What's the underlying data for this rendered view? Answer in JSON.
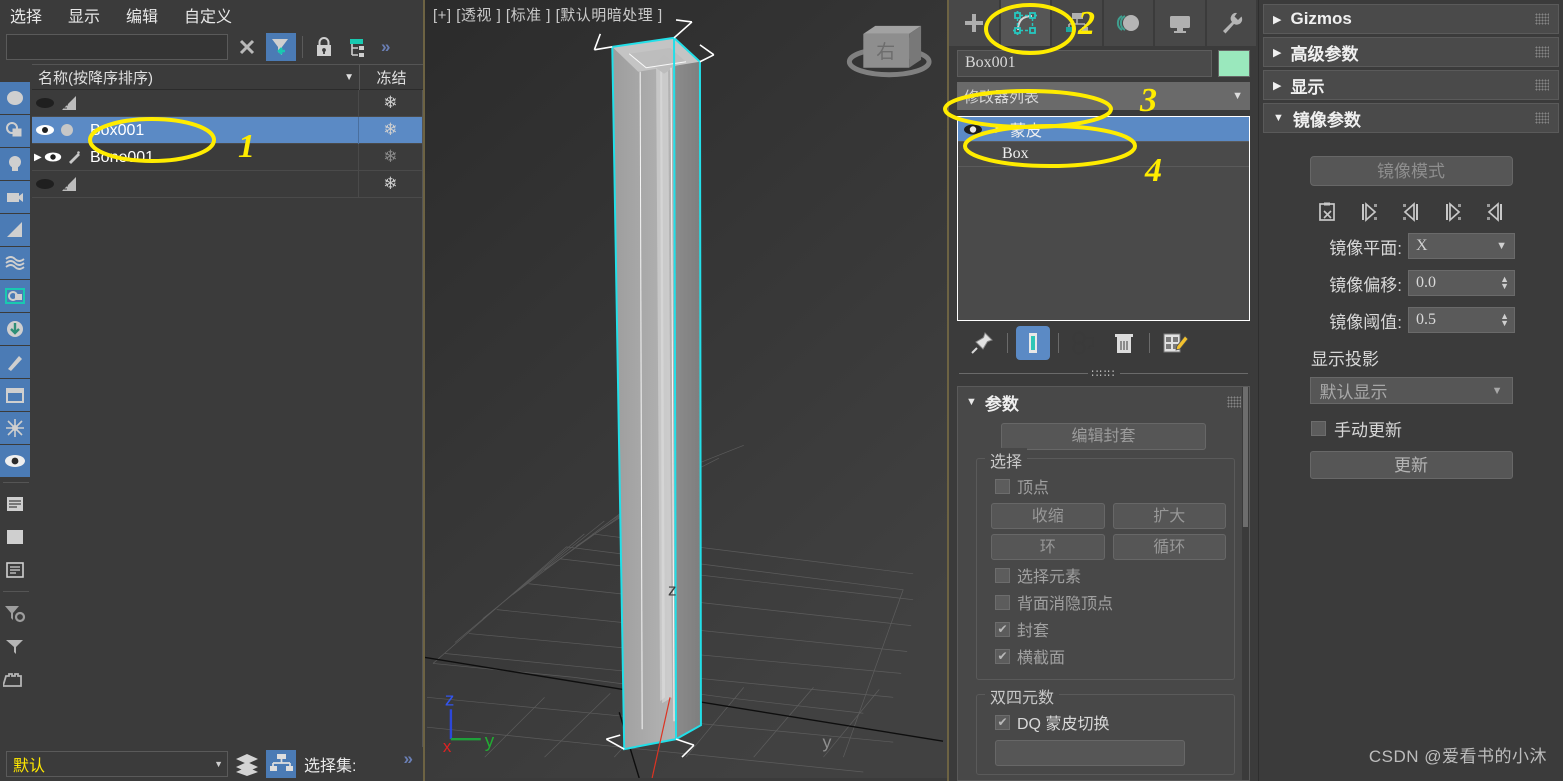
{
  "scene_explorer": {
    "menu": [
      "选择",
      "显示",
      "编辑",
      "自定义"
    ],
    "search_value": "",
    "search_placeholder": "",
    "toolbar_icons": [
      "clear-x-icon",
      "filter-icon",
      "lock-icon",
      "hierarchy-icon",
      "chevron-double-right-icon"
    ],
    "columns": {
      "name": "名称(按降序排序)",
      "frozen": "冻结"
    },
    "rows": [
      {
        "name": "",
        "selected": false,
        "visible": false,
        "type_icon": "helper-icon",
        "frozen_icon": "snowflake-icon"
      },
      {
        "name": "Box001",
        "selected": true,
        "visible": true,
        "type_icon": "geometry-icon",
        "frozen_icon": "snowflake-icon"
      },
      {
        "name": "Bone001",
        "selected": false,
        "visible": true,
        "type_icon": "bone-icon",
        "frozen_icon": "snowflake-icon"
      },
      {
        "name": "",
        "selected": false,
        "visible": false,
        "type_icon": "helper-icon",
        "frozen_icon": "snowflake-icon"
      }
    ],
    "rail_icons": [
      "geometry-sphere-icon",
      "shapes-icon",
      "lights-icon",
      "cameras-icon",
      "helpers-icon",
      "space-warps-icon",
      "groups-icon",
      "xrefs-icon",
      "bones-icon",
      "containers-icon",
      "particles-icon",
      "visibility-eye-icon",
      "layers-list-icon",
      "blank-square-icon",
      "properties-icon",
      "filter-gear-icon",
      "filter-funnel-icon",
      "container-icon"
    ],
    "bottom": {
      "layer_value": "默认",
      "layers_icon": "layers-stack-icon",
      "select_set_icon": "named-selection-sets-icon",
      "select_set_label": "选择集:",
      "overflow": "»"
    }
  },
  "viewport": {
    "label": "[+] [透视 ] [标准 ] [默认明暗处理 ]",
    "viewcube_label": "右",
    "axis_z": "z",
    "axis_y": "y",
    "gizmo": {
      "z": "z",
      "y": "y",
      "x": "x"
    }
  },
  "command_panel": {
    "tabs": [
      {
        "name": "create-tab",
        "icon": "plus-icon",
        "active": false
      },
      {
        "name": "modify-tab",
        "icon": "modify-bend-icon",
        "active": true
      },
      {
        "name": "hierarchy-tab",
        "icon": "hierarchy-icon",
        "active": false
      },
      {
        "name": "motion-tab",
        "icon": "motion-wheel-icon",
        "active": false
      },
      {
        "name": "display-tab",
        "icon": "display-monitor-icon",
        "active": false
      },
      {
        "name": "utilities-tab",
        "icon": "wrench-icon",
        "active": false
      }
    ],
    "object_name": "Box001",
    "object_color": "#9ae8bd",
    "modifier_list_label": "修改器列表",
    "stack": [
      {
        "label": "蒙皮",
        "selected": true,
        "has_eye": true,
        "expandable": true
      },
      {
        "label": "Box",
        "selected": false,
        "has_eye": false,
        "expandable": false
      }
    ],
    "stack_tools": [
      {
        "name": "pin-stack-icon",
        "active": false
      },
      {
        "name": "show-end-result-icon",
        "active": true
      },
      {
        "name": "make-unique-icon",
        "active": false
      },
      {
        "name": "remove-modifier-icon",
        "active": false
      },
      {
        "name": "configure-modifier-sets-icon",
        "active": false
      }
    ],
    "parameters": {
      "title": "参数",
      "edit_envelope": "编辑封套",
      "selection_group": "选择",
      "vertex_checkbox": "顶点",
      "shrink": "收缩",
      "grow": "扩大",
      "ring": "环",
      "loop": "循环",
      "select_element": "选择元素",
      "backface_cull_vertices": "背面消隐顶点",
      "envelope": "封套",
      "cross_section": "横截面",
      "dq_group": "双四元数",
      "dq_skin_toggle": "DQ 蒙皮切换"
    }
  },
  "right_panel": {
    "rollouts": [
      {
        "label": "Gizmos",
        "open": false
      },
      {
        "label": "高级参数",
        "open": false
      },
      {
        "label": "显示",
        "open": false
      },
      {
        "label": "镜像参数",
        "open": true
      }
    ],
    "mirror": {
      "mirror_mode_button": "镜像模式",
      "icons": [
        "mirror-paste-icon",
        "paste-blue-to-green-icon",
        "paste-green-to-blue-icon",
        "paste-blue-to-green-vertex-icon",
        "paste-green-to-blue-vertex-icon"
      ],
      "mirror_plane_label": "镜像平面:",
      "mirror_plane_value": "X",
      "mirror_offset_label": "镜像偏移:",
      "mirror_offset_value": "0.0",
      "mirror_threshold_label": "镜像阈值:",
      "mirror_threshold_value": "0.5",
      "display_projection_label": "显示投影",
      "display_projection_value": "默认显示",
      "manual_update_label": "手动更新",
      "manual_update_checked": false,
      "update_button": "更新"
    }
  },
  "annotations": [
    {
      "id": "1",
      "target": "Box001 scene explorer row"
    },
    {
      "id": "2",
      "target": "modify tab"
    },
    {
      "id": "3",
      "target": "modifier list dropdown"
    },
    {
      "id": "4",
      "target": "skin modifier in stack"
    }
  ],
  "watermark": "CSDN @爱看书的小沐"
}
